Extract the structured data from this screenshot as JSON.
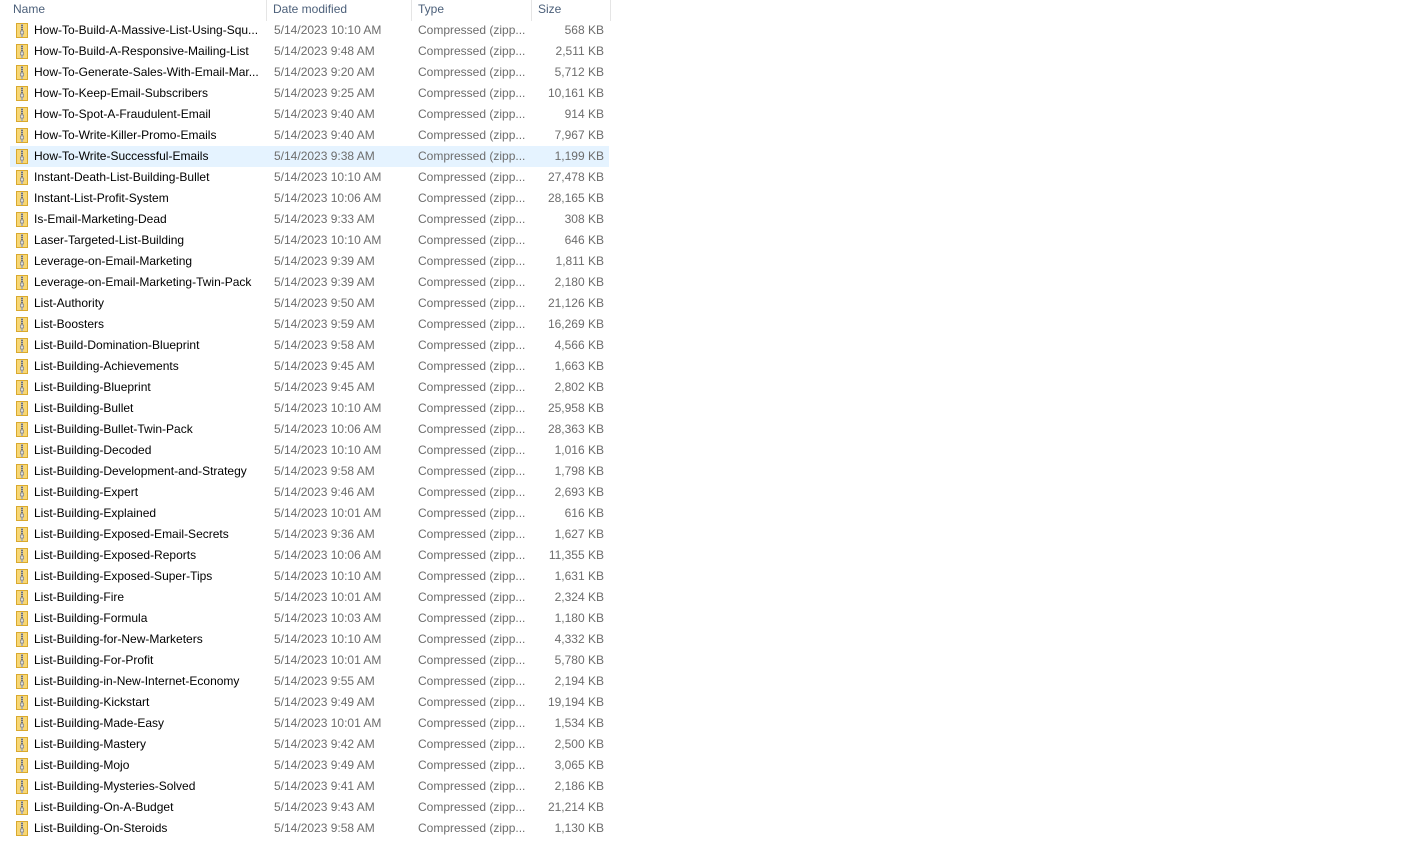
{
  "columns": {
    "name": "Name",
    "date": "Date modified",
    "type": "Type",
    "size": "Size"
  },
  "selected_index": 6,
  "files": [
    {
      "name": "How-To-Build-A-Massive-List-Using-Squ...",
      "date": "5/14/2023 10:10 AM",
      "type": "Compressed (zipp...",
      "size": "568 KB",
      "icon": "zip-folder-icon"
    },
    {
      "name": "How-To-Build-A-Responsive-Mailing-List",
      "date": "5/14/2023 9:48 AM",
      "type": "Compressed (zipp...",
      "size": "2,511 KB",
      "icon": "zip-folder-icon"
    },
    {
      "name": "How-To-Generate-Sales-With-Email-Mar...",
      "date": "5/14/2023 9:20 AM",
      "type": "Compressed (zipp...",
      "size": "5,712 KB",
      "icon": "zip-folder-icon"
    },
    {
      "name": "How-To-Keep-Email-Subscribers",
      "date": "5/14/2023 9:25 AM",
      "type": "Compressed (zipp...",
      "size": "10,161 KB",
      "icon": "zip-folder-icon"
    },
    {
      "name": "How-To-Spot-A-Fraudulent-Email",
      "date": "5/14/2023 9:40 AM",
      "type": "Compressed (zipp...",
      "size": "914 KB",
      "icon": "zip-folder-icon"
    },
    {
      "name": "How-To-Write-Killer-Promo-Emails",
      "date": "5/14/2023 9:40 AM",
      "type": "Compressed (zipp...",
      "size": "7,967 KB",
      "icon": "zip-folder-icon"
    },
    {
      "name": "How-To-Write-Successful-Emails",
      "date": "5/14/2023 9:38 AM",
      "type": "Compressed (zipp...",
      "size": "1,199 KB",
      "icon": "zip-folder-icon"
    },
    {
      "name": "Instant-Death-List-Building-Bullet",
      "date": "5/14/2023 10:10 AM",
      "type": "Compressed (zipp...",
      "size": "27,478 KB",
      "icon": "zip-folder-icon"
    },
    {
      "name": "Instant-List-Profit-System",
      "date": "5/14/2023 10:06 AM",
      "type": "Compressed (zipp...",
      "size": "28,165 KB",
      "icon": "zip-folder-icon"
    },
    {
      "name": "Is-Email-Marketing-Dead",
      "date": "5/14/2023 9:33 AM",
      "type": "Compressed (zipp...",
      "size": "308 KB",
      "icon": "zip-folder-icon"
    },
    {
      "name": "Laser-Targeted-List-Building",
      "date": "5/14/2023 10:10 AM",
      "type": "Compressed (zipp...",
      "size": "646 KB",
      "icon": "zip-folder-icon"
    },
    {
      "name": "Leverage-on-Email-Marketing",
      "date": "5/14/2023 9:39 AM",
      "type": "Compressed (zipp...",
      "size": "1,811 KB",
      "icon": "zip-folder-icon"
    },
    {
      "name": "Leverage-on-Email-Marketing-Twin-Pack",
      "date": "5/14/2023 9:39 AM",
      "type": "Compressed (zipp...",
      "size": "2,180 KB",
      "icon": "zip-folder-icon"
    },
    {
      "name": "List-Authority",
      "date": "5/14/2023 9:50 AM",
      "type": "Compressed (zipp...",
      "size": "21,126 KB",
      "icon": "zip-folder-icon"
    },
    {
      "name": "List-Boosters",
      "date": "5/14/2023 9:59 AM",
      "type": "Compressed (zipp...",
      "size": "16,269 KB",
      "icon": "zip-folder-icon"
    },
    {
      "name": "List-Build-Domination-Blueprint",
      "date": "5/14/2023 9:58 AM",
      "type": "Compressed (zipp...",
      "size": "4,566 KB",
      "icon": "zip-folder-icon"
    },
    {
      "name": "List-Building-Achievements",
      "date": "5/14/2023 9:45 AM",
      "type": "Compressed (zipp...",
      "size": "1,663 KB",
      "icon": "zip-folder-icon"
    },
    {
      "name": "List-Building-Blueprint",
      "date": "5/14/2023 9:45 AM",
      "type": "Compressed (zipp...",
      "size": "2,802 KB",
      "icon": "zip-folder-icon"
    },
    {
      "name": "List-Building-Bullet",
      "date": "5/14/2023 10:10 AM",
      "type": "Compressed (zipp...",
      "size": "25,958 KB",
      "icon": "zip-folder-icon"
    },
    {
      "name": "List-Building-Bullet-Twin-Pack",
      "date": "5/14/2023 10:06 AM",
      "type": "Compressed (zipp...",
      "size": "28,363 KB",
      "icon": "zip-folder-icon"
    },
    {
      "name": "List-Building-Decoded",
      "date": "5/14/2023 10:10 AM",
      "type": "Compressed (zipp...",
      "size": "1,016 KB",
      "icon": "zip-folder-icon"
    },
    {
      "name": "List-Building-Development-and-Strategy",
      "date": "5/14/2023 9:58 AM",
      "type": "Compressed (zipp...",
      "size": "1,798 KB",
      "icon": "zip-folder-icon"
    },
    {
      "name": "List-Building-Expert",
      "date": "5/14/2023 9:46 AM",
      "type": "Compressed (zipp...",
      "size": "2,693 KB",
      "icon": "zip-folder-icon"
    },
    {
      "name": "List-Building-Explained",
      "date": "5/14/2023 10:01 AM",
      "type": "Compressed (zipp...",
      "size": "616 KB",
      "icon": "zip-folder-icon"
    },
    {
      "name": "List-Building-Exposed-Email-Secrets",
      "date": "5/14/2023 9:36 AM",
      "type": "Compressed (zipp...",
      "size": "1,627 KB",
      "icon": "zip-folder-icon"
    },
    {
      "name": "List-Building-Exposed-Reports",
      "date": "5/14/2023 10:06 AM",
      "type": "Compressed (zipp...",
      "size": "11,355 KB",
      "icon": "zip-folder-icon"
    },
    {
      "name": "List-Building-Exposed-Super-Tips",
      "date": "5/14/2023 10:10 AM",
      "type": "Compressed (zipp...",
      "size": "1,631 KB",
      "icon": "zip-folder-icon"
    },
    {
      "name": "List-Building-Fire",
      "date": "5/14/2023 10:01 AM",
      "type": "Compressed (zipp...",
      "size": "2,324 KB",
      "icon": "zip-folder-icon"
    },
    {
      "name": "List-Building-Formula",
      "date": "5/14/2023 10:03 AM",
      "type": "Compressed (zipp...",
      "size": "1,180 KB",
      "icon": "zip-folder-icon"
    },
    {
      "name": "List-Building-for-New-Marketers",
      "date": "5/14/2023 10:10 AM",
      "type": "Compressed (zipp...",
      "size": "4,332 KB",
      "icon": "zip-folder-icon"
    },
    {
      "name": "List-Building-For-Profit",
      "date": "5/14/2023 10:01 AM",
      "type": "Compressed (zipp...",
      "size": "5,780 KB",
      "icon": "zip-folder-icon"
    },
    {
      "name": "List-Building-in-New-Internet-Economy",
      "date": "5/14/2023 9:55 AM",
      "type": "Compressed (zipp...",
      "size": "2,194 KB",
      "icon": "zip-folder-icon"
    },
    {
      "name": "List-Building-Kickstart",
      "date": "5/14/2023 9:49 AM",
      "type": "Compressed (zipp...",
      "size": "19,194 KB",
      "icon": "zip-folder-icon"
    },
    {
      "name": "List-Building-Made-Easy",
      "date": "5/14/2023 10:01 AM",
      "type": "Compressed (zipp...",
      "size": "1,534 KB",
      "icon": "zip-folder-icon"
    },
    {
      "name": "List-Building-Mastery",
      "date": "5/14/2023 9:42 AM",
      "type": "Compressed (zipp...",
      "size": "2,500 KB",
      "icon": "zip-folder-icon"
    },
    {
      "name": "List-Building-Mojo",
      "date": "5/14/2023 9:49 AM",
      "type": "Compressed (zipp...",
      "size": "3,065 KB",
      "icon": "zip-folder-icon"
    },
    {
      "name": "List-Building-Mysteries-Solved",
      "date": "5/14/2023 9:41 AM",
      "type": "Compressed (zipp...",
      "size": "2,186 KB",
      "icon": "zip-folder-icon"
    },
    {
      "name": "List-Building-On-A-Budget",
      "date": "5/14/2023 9:43 AM",
      "type": "Compressed (zipp...",
      "size": "21,214 KB",
      "icon": "zip-folder-icon"
    },
    {
      "name": "List-Building-On-Steroids",
      "date": "5/14/2023 9:58 AM",
      "type": "Compressed (zipp...",
      "size": "1,130 KB",
      "icon": "zip-folder-icon"
    }
  ]
}
